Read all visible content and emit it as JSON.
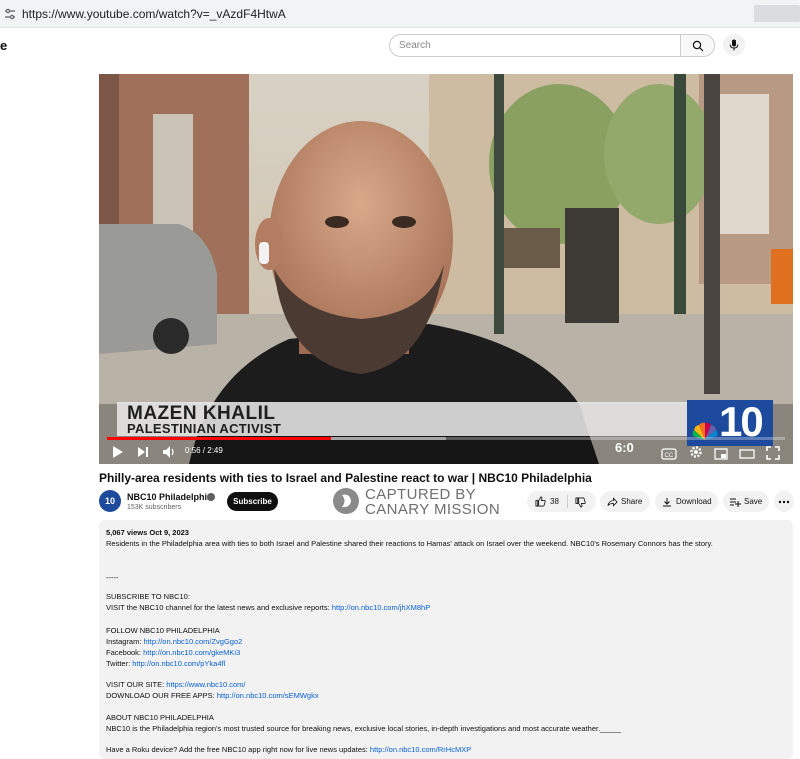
{
  "browser": {
    "url": "https://www.youtube.com/watch?v=_vAzdF4HtwA"
  },
  "header": {
    "logo_fragment": "e",
    "search_placeholder": "Search"
  },
  "player": {
    "lower_third_name": "MAZEN KHALIL",
    "lower_third_title": "PALESTINIAN ACTIVIST",
    "station_number": "10",
    "bug_time": "6:0",
    "time_display": "0:56 / 2:49",
    "progress_fraction": 0.33,
    "buffer_fraction": 0.5
  },
  "video": {
    "title": "Philly-area residents with ties to Israel and Palestine react to war | NBC10 Philadelphia"
  },
  "channel": {
    "avatar_text": "10",
    "name": "NBC10 Philadelphia",
    "subscribers": "153K subscribers",
    "subscribe_label": "Subscribe"
  },
  "watermark": {
    "line1": "CAPTURED BY",
    "line2": "CANARY MISSION"
  },
  "actions": {
    "likes": "38",
    "share_label": "Share",
    "download_label": "Download",
    "save_label": "Save"
  },
  "description": {
    "meta": "5,067 views  Oct 9, 2023",
    "summary": "Residents in the Philadelphia area with ties to both Israel and Palestine shared their reactions to Hamas' attack on Israel over the weekend. NBC10's Rosemary Connors has the story.",
    "divider": "-----",
    "subscribe_heading": "SUBSCRIBE TO NBC10:",
    "visit_channel_text": "VISIT the NBC10 channel for the latest news and exclusive reports: ",
    "visit_channel_link": "http://on.nbc10.com/jhXM8hP",
    "follow_heading": "FOLLOW NBC10 PHILADELPHIA",
    "instagram_label": "Instagram: ",
    "instagram_link": "http://on.nbc10.com/ZvgGgo2",
    "facebook_label": "Facebook: ",
    "facebook_link": "http://on.nbc10.com/gkeMKi3",
    "twitter_label": "Twitter: ",
    "twitter_link": "http://on.nbc10.com/pYka4fl",
    "site_label": "VISIT OUR SITE: ",
    "site_link": "https://www.nbc10.com/",
    "apps_label": "DOWNLOAD OUR FREE APPS: ",
    "apps_link": "http://on.nbc10.com/sEMWgkx",
    "about_heading": "ABOUT NBC10 PHILADELPHIA",
    "about_text": "NBC10 is the Philadelphia region's most trusted source for breaking news, exclusive local stories, in-depth investigations and most accurate weather._____",
    "roku_text": "Have a Roku device? Add the free NBC10 app right now for live news updates: ",
    "roku_link": "http://on.nbc10.com/RrHcMXP"
  },
  "colors": {
    "progress": "#ff0000",
    "nbc_blue": "#1d4a9c",
    "link": "#065fd4"
  }
}
